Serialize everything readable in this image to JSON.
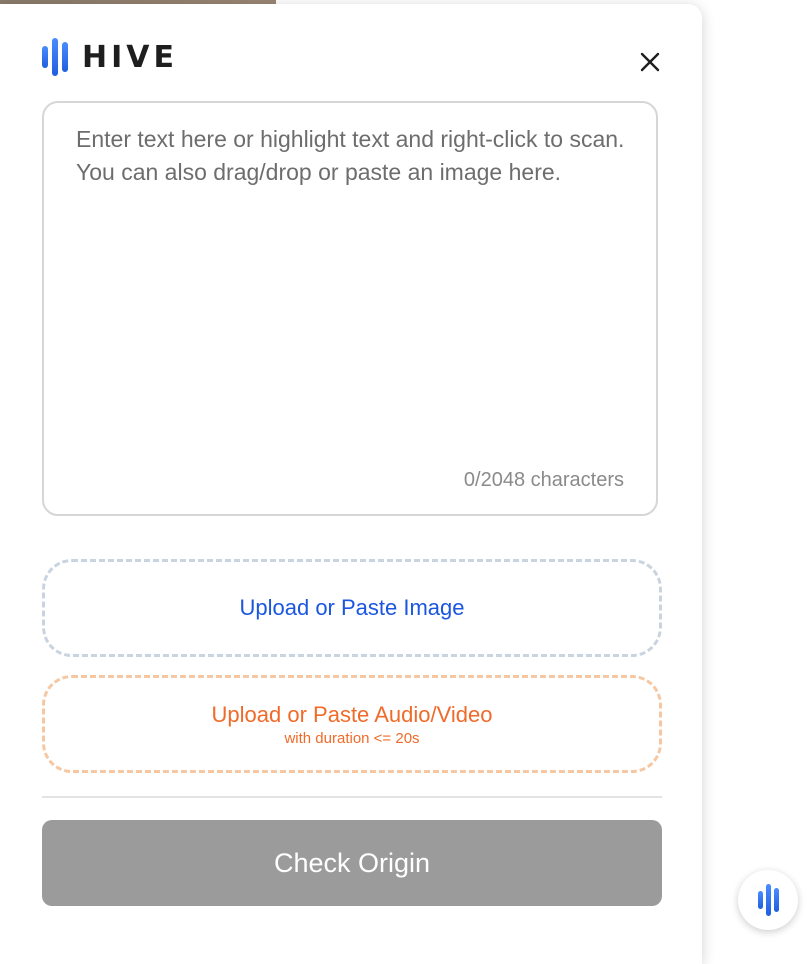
{
  "brand": {
    "name": "HIVE",
    "accent_color": "#1f5fe0",
    "icon": "hive-logo-icon"
  },
  "header": {
    "close_icon": "close-icon"
  },
  "text_input": {
    "value": "",
    "placeholder": "Enter text here or highlight text and right-click to scan. You can also drag/drop or paste an image here.",
    "char_count": "0/2048 characters"
  },
  "upload_image": {
    "label": "Upload or Paste Image",
    "color": "#1a56e0"
  },
  "upload_audio_video": {
    "label": "Upload or Paste Audio/Video",
    "sublabel": "with duration <= 20s",
    "color": "#f06b2a"
  },
  "actions": {
    "check_label": "Check Origin"
  },
  "launcher": {
    "icon": "hive-logo-icon"
  }
}
